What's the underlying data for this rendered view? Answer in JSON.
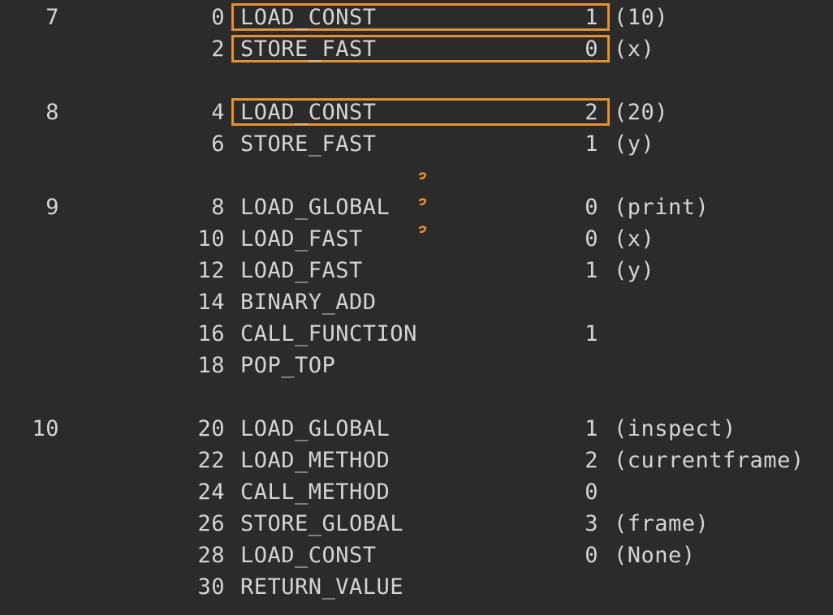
{
  "highlight_color": "#e8902e",
  "background_color": "#2b2b2b",
  "text_color": "#d4d4d4",
  "rows": [
    {
      "src": "7",
      "offset": "0",
      "opcode": "LOAD_CONST",
      "arg": "1",
      "repr": "(10)",
      "highlighted": true
    },
    {
      "src": "",
      "offset": "2",
      "opcode": "STORE_FAST",
      "arg": "0",
      "repr": "(x)",
      "highlighted": true
    },
    {
      "src": "8",
      "offset": "4",
      "opcode": "LOAD_CONST",
      "arg": "2",
      "repr": "(20)",
      "highlighted": true
    },
    {
      "src": "",
      "offset": "6",
      "opcode": "STORE_FAST",
      "arg": "1",
      "repr": "(y)",
      "highlighted": false
    },
    {
      "src": "9",
      "offset": "8",
      "opcode": "LOAD_GLOBAL",
      "arg": "0",
      "repr": "(print)",
      "highlighted": false
    },
    {
      "src": "",
      "offset": "10",
      "opcode": "LOAD_FAST",
      "arg": "0",
      "repr": "(x)",
      "highlighted": false
    },
    {
      "src": "",
      "offset": "12",
      "opcode": "LOAD_FAST",
      "arg": "1",
      "repr": "(y)",
      "highlighted": false
    },
    {
      "src": "",
      "offset": "14",
      "opcode": "BINARY_ADD",
      "arg": "",
      "repr": "",
      "highlighted": false
    },
    {
      "src": "",
      "offset": "16",
      "opcode": "CALL_FUNCTION",
      "arg": "1",
      "repr": "",
      "highlighted": false
    },
    {
      "src": "",
      "offset": "18",
      "opcode": "POP_TOP",
      "arg": "",
      "repr": "",
      "highlighted": false
    },
    {
      "src": "10",
      "offset": "20",
      "opcode": "LOAD_GLOBAL",
      "arg": "1",
      "repr": "(inspect)",
      "highlighted": false
    },
    {
      "src": "",
      "offset": "22",
      "opcode": "LOAD_METHOD",
      "arg": "2",
      "repr": "(currentframe)",
      "highlighted": false
    },
    {
      "src": "",
      "offset": "24",
      "opcode": "CALL_METHOD",
      "arg": "0",
      "repr": "",
      "highlighted": false
    },
    {
      "src": "",
      "offset": "26",
      "opcode": "STORE_GLOBAL",
      "arg": "3",
      "repr": "(frame)",
      "highlighted": false
    },
    {
      "src": "",
      "offset": "28",
      "opcode": "LOAD_CONST",
      "arg": "0",
      "repr": "(None)",
      "highlighted": false
    },
    {
      "src": "",
      "offset": "30",
      "opcode": "RETURN_VALUE",
      "arg": "",
      "repr": "",
      "highlighted": false
    }
  ]
}
